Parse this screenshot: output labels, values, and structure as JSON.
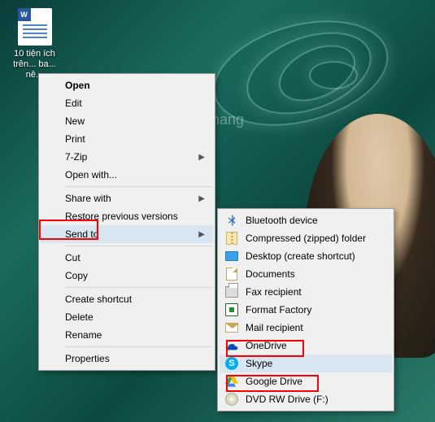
{
  "desktop_icon": {
    "label": "10 tiện ích trên... ba... nê...",
    "doc_badge": "W"
  },
  "watermark": "uantrimang",
  "context_menu": {
    "open": "Open",
    "edit": "Edit",
    "new": "New",
    "print": "Print",
    "seven_zip": "7-Zip",
    "open_with": "Open with...",
    "share_with": "Share with",
    "restore_prev": "Restore previous versions",
    "send_to": "Send to",
    "cut": "Cut",
    "copy": "Copy",
    "create_shortcut": "Create shortcut",
    "delete": "Delete",
    "rename": "Rename",
    "properties": "Properties"
  },
  "send_to_menu": {
    "bluetooth": "Bluetooth device",
    "zip": "Compressed (zipped) folder",
    "desktop": "Desktop (create shortcut)",
    "documents": "Documents",
    "fax": "Fax recipient",
    "format_factory": "Format Factory",
    "mail": "Mail recipient",
    "onedrive": "OneDrive",
    "skype": "Skype",
    "google_drive": "Google Drive",
    "dvd": "DVD RW Drive (F:)"
  }
}
